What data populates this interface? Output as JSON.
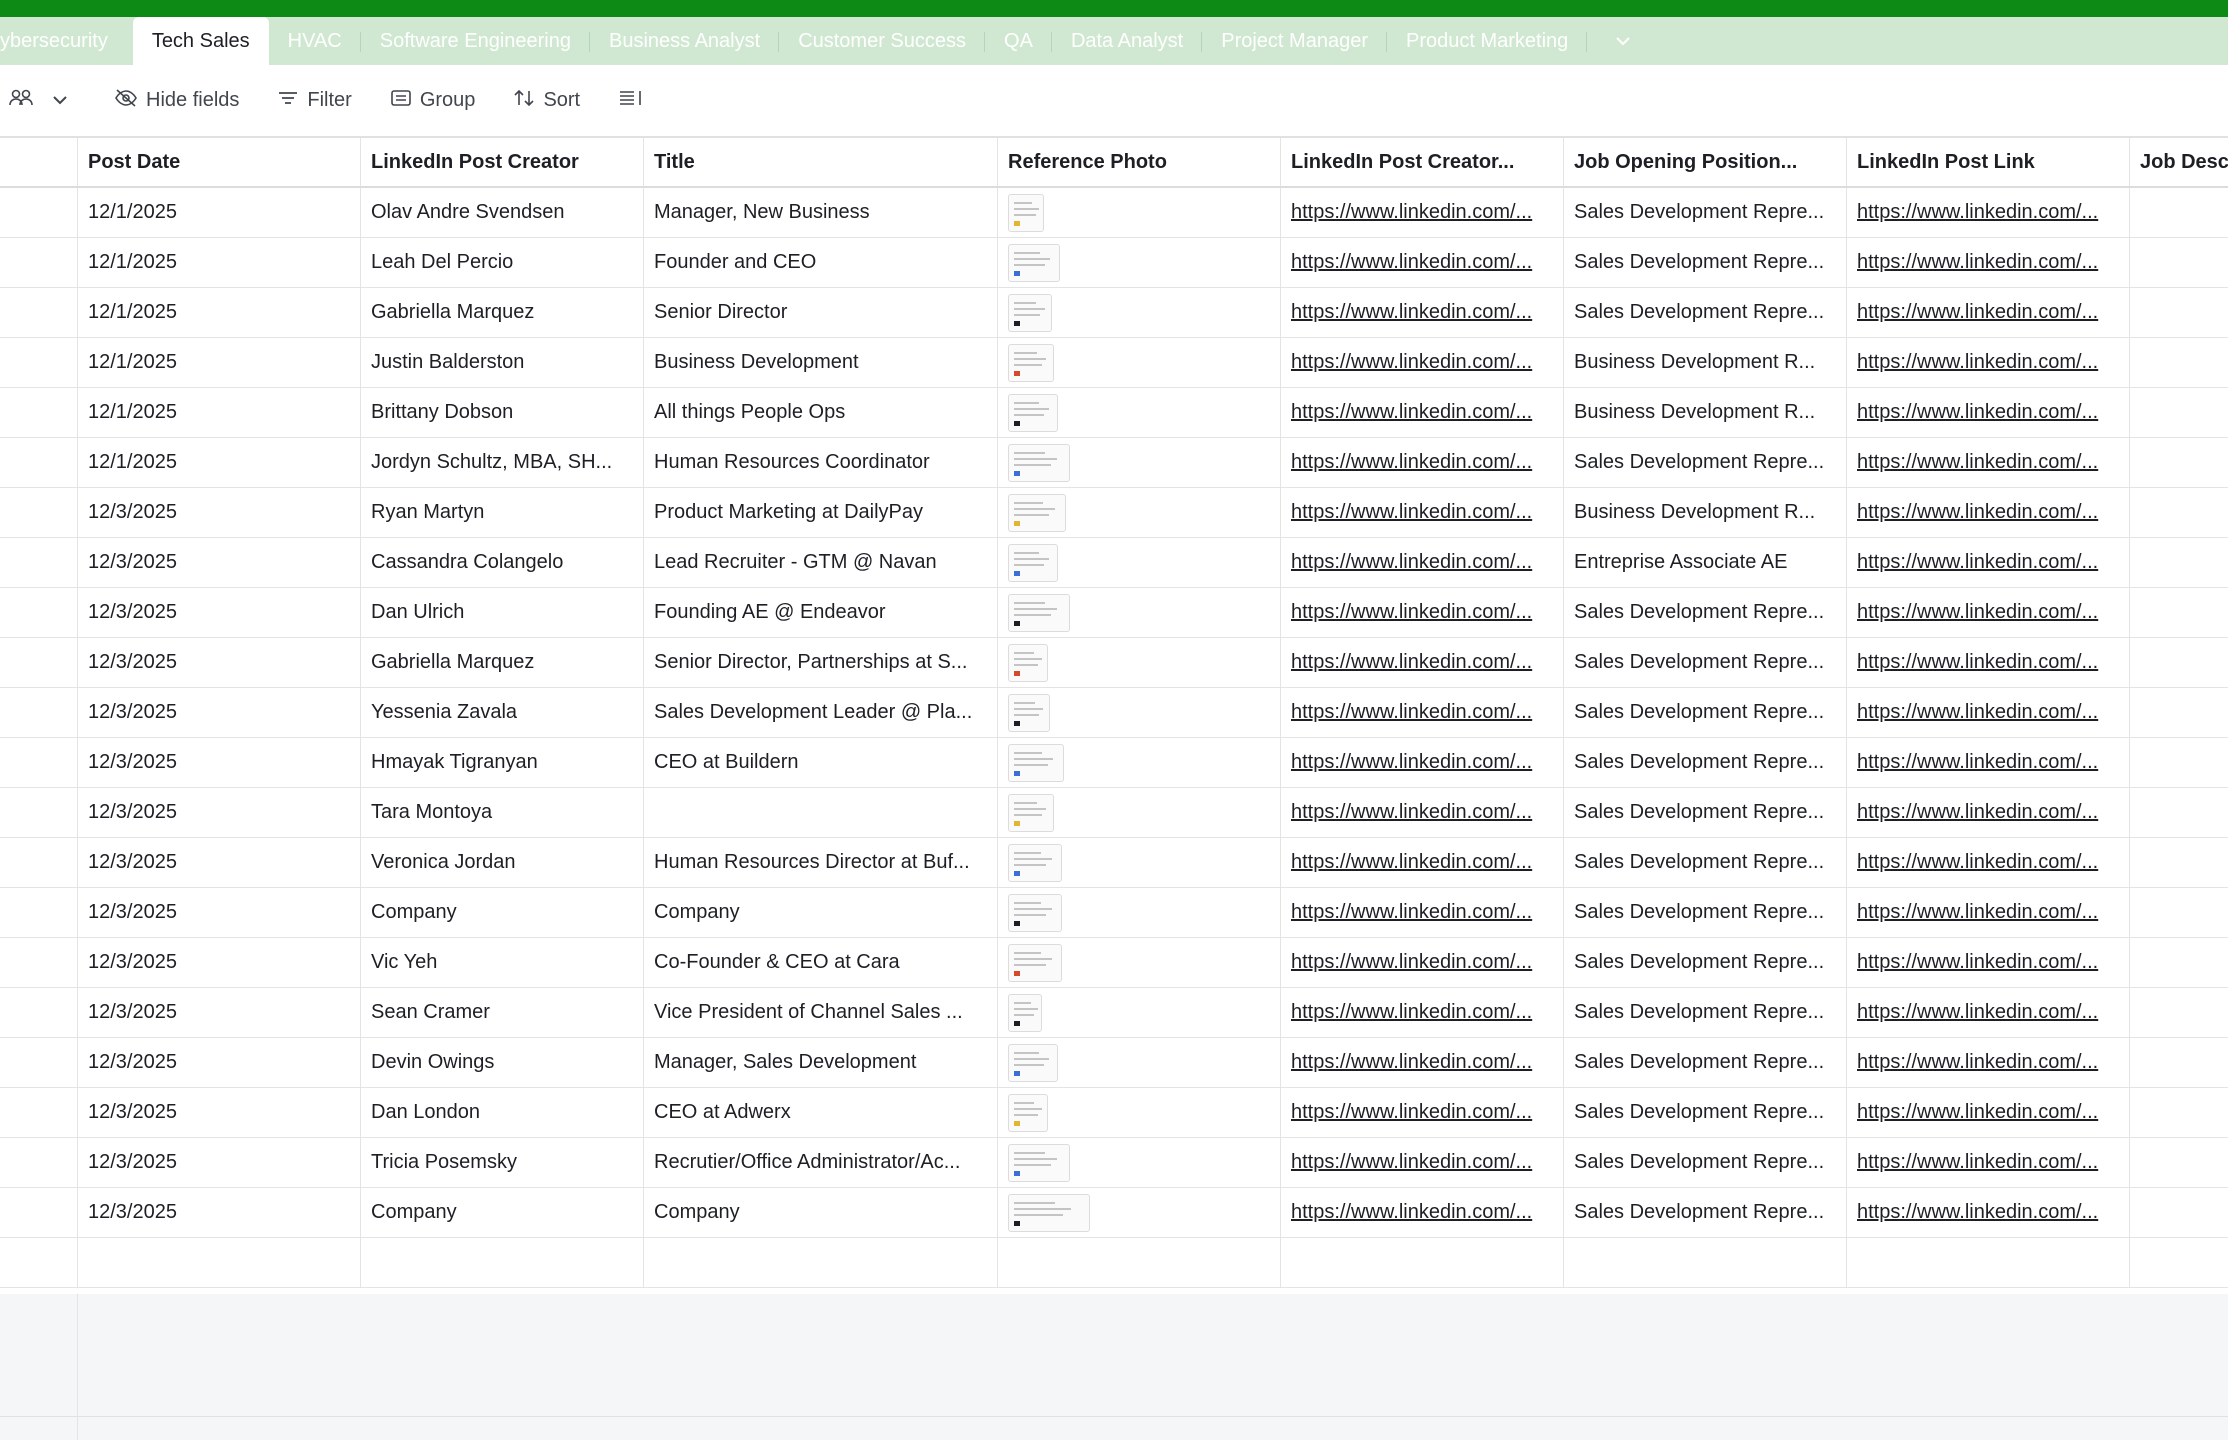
{
  "tabs": [
    {
      "label": "ybersecurity",
      "active": false
    },
    {
      "label": "Tech Sales",
      "active": true
    },
    {
      "label": "HVAC",
      "active": false
    },
    {
      "label": "Software Engineering",
      "active": false
    },
    {
      "label": "Business Analyst",
      "active": false
    },
    {
      "label": "Customer Success",
      "active": false
    },
    {
      "label": "QA",
      "active": false
    },
    {
      "label": "Data Analyst",
      "active": false
    },
    {
      "label": "Project Manager",
      "active": false
    },
    {
      "label": "Product Marketing",
      "active": false
    }
  ],
  "toolbar": {
    "hide_fields": "Hide fields",
    "filter": "Filter",
    "group": "Group",
    "sort": "Sort"
  },
  "columns": [
    "Post Date",
    "LinkedIn Post Creator",
    "Title",
    "Reference Photo",
    "LinkedIn Post Creator...",
    "Job Opening Position...",
    "LinkedIn Post Link",
    "Job Desc"
  ],
  "rows": [
    {
      "date": "12/1/2025",
      "creator": "Olav Andre Svendsen",
      "title": "Manager, New Business",
      "creator_link": "https://www.linkedin.com/...",
      "position": "Sales Development Repre...",
      "post_link": "https://www.linkedin.com/..."
    },
    {
      "date": "12/1/2025",
      "creator": "Leah Del Percio",
      "title": "Founder and CEO",
      "creator_link": "https://www.linkedin.com/...",
      "position": "Sales Development Repre...",
      "post_link": "https://www.linkedin.com/..."
    },
    {
      "date": "12/1/2025",
      "creator": "Gabriella Marquez",
      "title": "Senior Director",
      "creator_link": "https://www.linkedin.com/...",
      "position": "Sales Development Repre...",
      "post_link": "https://www.linkedin.com/..."
    },
    {
      "date": "12/1/2025",
      "creator": "Justin Balderston",
      "title": "Business Development",
      "creator_link": "https://www.linkedin.com/...",
      "position": "Business Development R...",
      "post_link": "https://www.linkedin.com/..."
    },
    {
      "date": "12/1/2025",
      "creator": "Brittany Dobson",
      "title": "All things People Ops",
      "creator_link": "https://www.linkedin.com/...",
      "position": "Business Development R...",
      "post_link": "https://www.linkedin.com/..."
    },
    {
      "date": "12/1/2025",
      "creator": "Jordyn Schultz, MBA, SH...",
      "title": "Human Resources Coordinator",
      "creator_link": "https://www.linkedin.com/...",
      "position": "Sales Development Repre...",
      "post_link": "https://www.linkedin.com/..."
    },
    {
      "date": "12/3/2025",
      "creator": "Ryan Martyn",
      "title": "Product Marketing at DailyPay",
      "creator_link": "https://www.linkedin.com/...",
      "position": "Business Development R...",
      "post_link": "https://www.linkedin.com/..."
    },
    {
      "date": "12/3/2025",
      "creator": "Cassandra Colangelo",
      "title": "Lead Recruiter - GTM @ Navan",
      "creator_link": "https://www.linkedin.com/...",
      "position": "Entreprise Associate AE",
      "post_link": "https://www.linkedin.com/..."
    },
    {
      "date": "12/3/2025",
      "creator": "Dan Ulrich",
      "title": "Founding AE @ Endeavor",
      "creator_link": "https://www.linkedin.com/...",
      "position": "Sales Development Repre...",
      "post_link": "https://www.linkedin.com/..."
    },
    {
      "date": "12/3/2025",
      "creator": "Gabriella Marquez",
      "title": "Senior Director, Partnerships at S...",
      "creator_link": "https://www.linkedin.com/...",
      "position": "Sales Development Repre...",
      "post_link": "https://www.linkedin.com/..."
    },
    {
      "date": "12/3/2025",
      "creator": "Yessenia Zavala",
      "title": "Sales Development Leader @ Pla...",
      "creator_link": "https://www.linkedin.com/...",
      "position": "Sales Development Repre...",
      "post_link": "https://www.linkedin.com/..."
    },
    {
      "date": "12/3/2025",
      "creator": "Hmayak Tigranyan",
      "title": "CEO at Buildern",
      "creator_link": "https://www.linkedin.com/...",
      "position": "Sales Development Repre...",
      "post_link": "https://www.linkedin.com/..."
    },
    {
      "date": "12/3/2025",
      "creator": "Tara Montoya",
      "title": "",
      "creator_link": "https://www.linkedin.com/...",
      "position": "Sales Development Repre...",
      "post_link": "https://www.linkedin.com/..."
    },
    {
      "date": "12/3/2025",
      "creator": "Veronica Jordan",
      "title": "Human Resources Director at Buf...",
      "creator_link": "https://www.linkedin.com/...",
      "position": "Sales Development Repre...",
      "post_link": "https://www.linkedin.com/..."
    },
    {
      "date": "12/3/2025",
      "creator": "Company",
      "title": "Company",
      "creator_link": "https://www.linkedin.com/...",
      "position": "Sales Development Repre...",
      "post_link": "https://www.linkedin.com/..."
    },
    {
      "date": "12/3/2025",
      "creator": "Vic Yeh",
      "title": "Co-Founder & CEO at Cara",
      "creator_link": "https://www.linkedin.com/...",
      "position": "Sales Development Repre...",
      "post_link": "https://www.linkedin.com/..."
    },
    {
      "date": "12/3/2025",
      "creator": "Sean Cramer",
      "title": "Vice President of Channel Sales ...",
      "creator_link": "https://www.linkedin.com/...",
      "position": "Sales Development Repre...",
      "post_link": "https://www.linkedin.com/..."
    },
    {
      "date": "12/3/2025",
      "creator": "Devin Owings",
      "title": "Manager, Sales Development",
      "creator_link": "https://www.linkedin.com/...",
      "position": "Sales Development Repre...",
      "post_link": "https://www.linkedin.com/..."
    },
    {
      "date": "12/3/2025",
      "creator": "Dan London",
      "title": "CEO at Adwerx",
      "creator_link": "https://www.linkedin.com/...",
      "position": "Sales Development Repre...",
      "post_link": "https://www.linkedin.com/..."
    },
    {
      "date": "12/3/2025",
      "creator": "Tricia Posemsky",
      "title": "Recrutier/Office Administrator/Ac...",
      "creator_link": "https://www.linkedin.com/...",
      "position": "Sales Development Repre...",
      "post_link": "https://www.linkedin.com/..."
    },
    {
      "date": "12/3/2025",
      "creator": "Company",
      "title": "Company",
      "creator_link": "https://www.linkedin.com/...",
      "position": "Sales Development Repre...",
      "post_link": "https://www.linkedin.com/..."
    }
  ],
  "colors": {
    "topbar": "#0c8a15",
    "tabbar": "#d0e8d1",
    "empty_area": "#f5f6f8"
  },
  "icons": [
    "people-icon",
    "chevron-down-icon",
    "hide-fields-icon",
    "filter-icon",
    "group-icon",
    "sort-icon",
    "row-height-icon"
  ]
}
